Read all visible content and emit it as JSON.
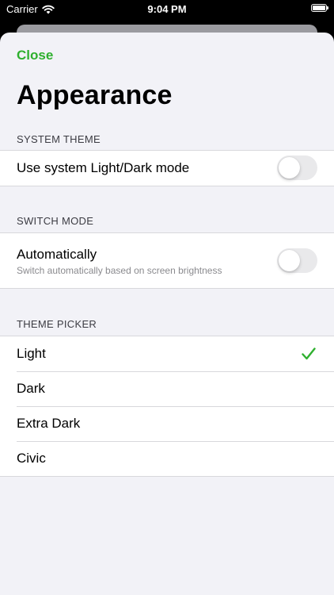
{
  "status_bar": {
    "carrier": "Carrier",
    "time": "9:04 PM",
    "battery_level": 1.0
  },
  "sheet": {
    "close_label": "Close",
    "title": "Appearance"
  },
  "sections": {
    "system_theme": {
      "header": "SYSTEM THEME",
      "row_label": "Use system Light/Dark mode",
      "toggle_on": false
    },
    "switch_mode": {
      "header": "SWITCH MODE",
      "row_label": "Automatically",
      "row_subtitle": "Switch automatically based on screen brightness",
      "toggle_on": false
    },
    "theme_picker": {
      "header": "THEME PICKER",
      "options": [
        "Light",
        "Dark",
        "Extra Dark",
        "Civic"
      ],
      "selected": "Light"
    }
  },
  "colors": {
    "accent": "#2fb02f",
    "background": "#f2f2f7",
    "toggle_off": "#e9e9eb"
  },
  "icons": {
    "wifi": "wifi-icon",
    "battery": "battery-icon",
    "checkmark": "checkmark-icon"
  }
}
